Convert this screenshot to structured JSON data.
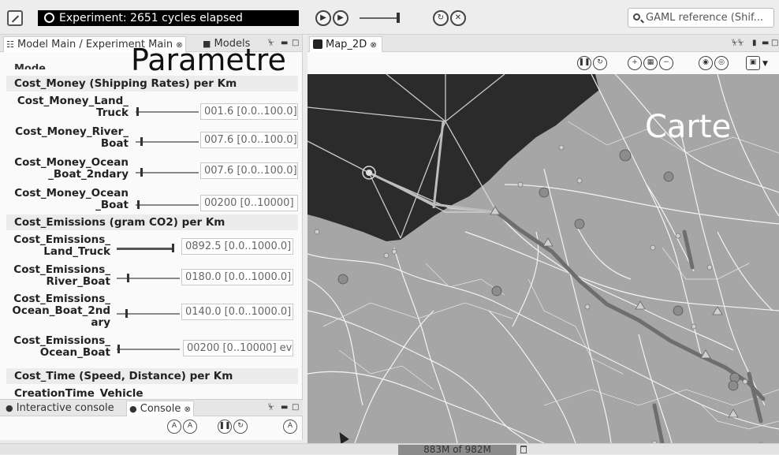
{
  "toolbar": {
    "status_text": "Experiment: 2651 cycles elapsed",
    "search_placeholder": "GAML reference (Shif..."
  },
  "left_panel": {
    "tabs": [
      "Model Main / Experiment Main",
      "Models"
    ],
    "title": "Parametre",
    "groups": [
      {
        "name": "Cost_Money (Shipping Rates) per Km",
        "params": [
          {
            "label": [
              "Cost_Money_Land_",
              "Truck"
            ],
            "value": "001.6 [0.0..100.0]"
          },
          {
            "label": [
              "Cost_Money_River_",
              "Boat"
            ],
            "value": "007.6 [0.0..100.0]"
          },
          {
            "label": [
              "Cost_Money_Ocean",
              "_Boat_2ndary"
            ],
            "value": "007.6 [0.0..100.0]"
          },
          {
            "label": [
              "Cost_Money_Ocean",
              "_Boat"
            ],
            "value": "00200 [0..10000]"
          }
        ]
      },
      {
        "name": "Cost_Emissions (gram CO2) per Km",
        "params": [
          {
            "label": [
              "Cost_Emissions_",
              "Land_Truck"
            ],
            "value": "0892.5 [0.0..1000.0]"
          },
          {
            "label": [
              "Cost_Emissions_",
              "River_Boat"
            ],
            "value": "0180.0 [0.0..1000.0]"
          },
          {
            "label": [
              "Cost_Emissions_",
              "Ocean_Boat_2nd",
              "ary"
            ],
            "value": "0140.0 [0.0..1000.0]"
          },
          {
            "label": [
              "Cost_Emissions_",
              "Ocean_Boat"
            ],
            "value": "00200 [0..10000] eve"
          }
        ]
      },
      {
        "name": "Cost_Time (Speed, Distance) per Km",
        "params": []
      }
    ],
    "partial_text": "CreationTime_Vehicle"
  },
  "console": {
    "tabs": [
      "Interactive console",
      "Console"
    ]
  },
  "map": {
    "tab": "Map_2D",
    "title": "Carte"
  },
  "statusbar": {
    "memory": "883M of 982M"
  },
  "colors": {
    "status_bg": "#000000",
    "sea": "#2b2b2b",
    "land": "#a6a6a6",
    "roads": "#f4f4f4",
    "routes": "#6e6e6e"
  }
}
